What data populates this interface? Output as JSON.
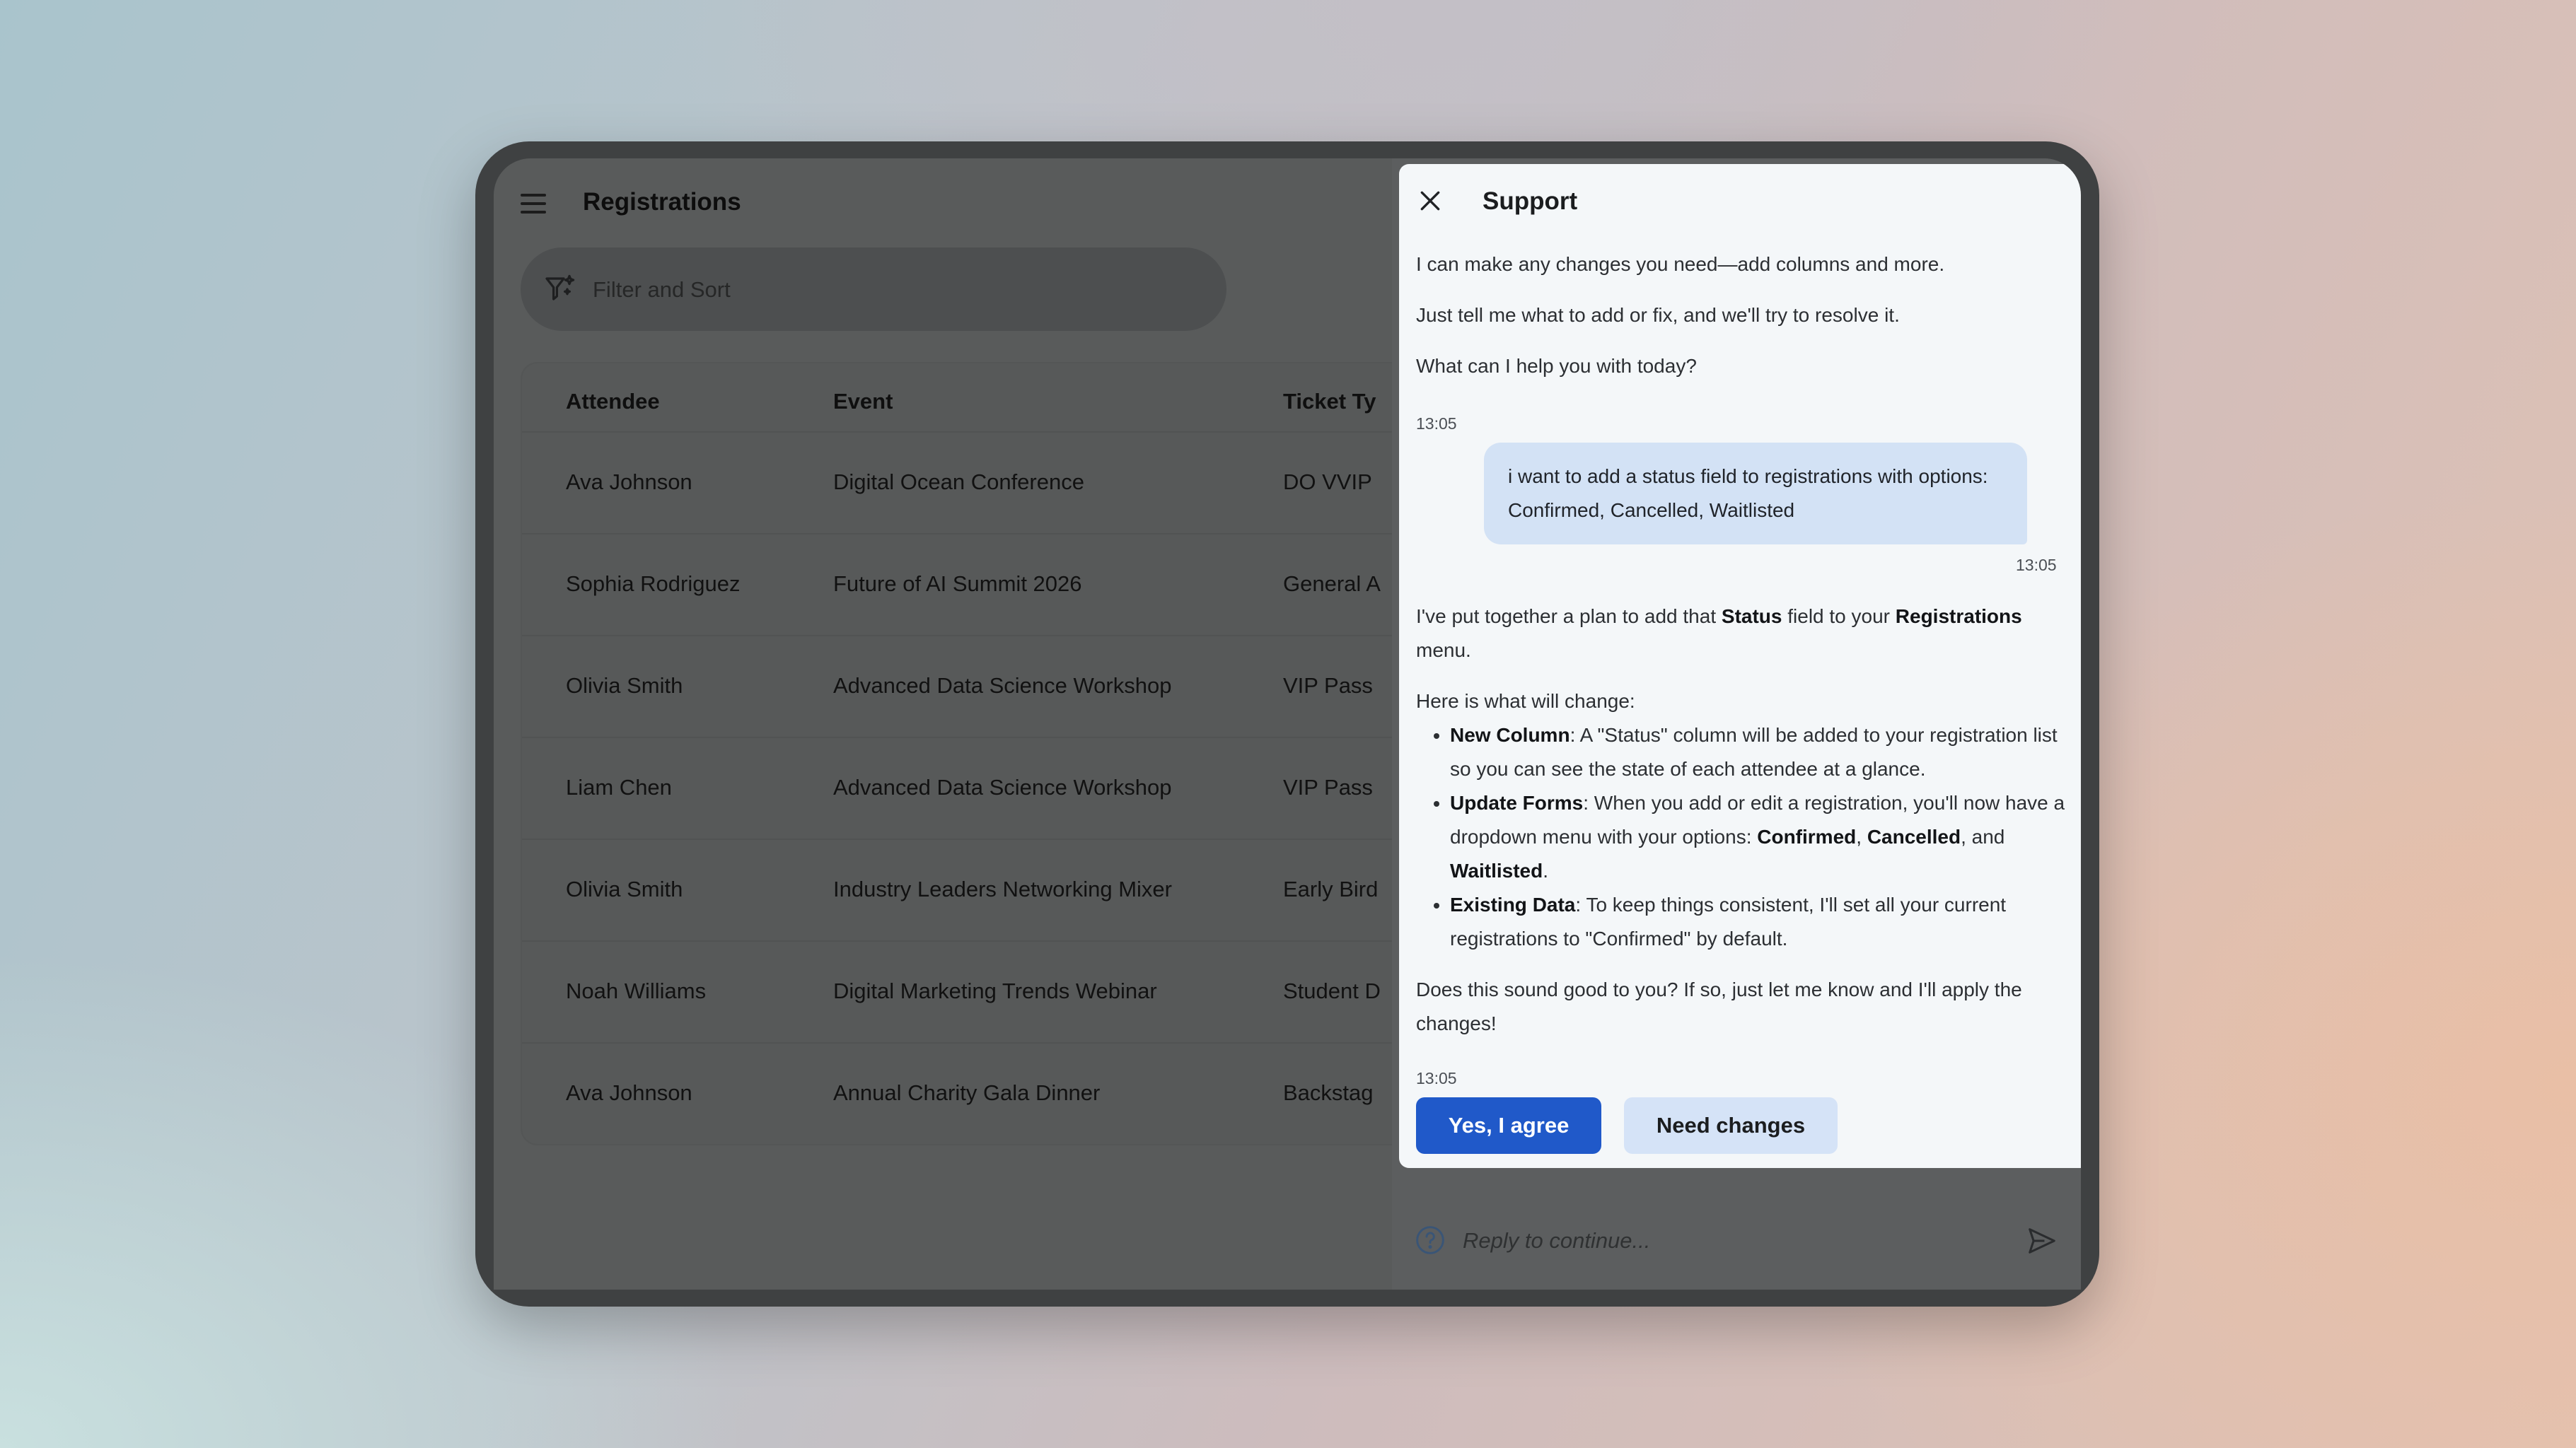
{
  "app": {
    "title": "Registrations",
    "filter_placeholder": "Filter and Sort"
  },
  "table": {
    "headers": [
      "Attendee",
      "Event",
      "Ticket Ty"
    ],
    "rows": [
      [
        "Ava Johnson",
        "Digital Ocean Conference",
        "DO VVIP"
      ],
      [
        "Sophia Rodriguez",
        "Future of AI Summit 2026",
        "General A"
      ],
      [
        "Olivia Smith",
        "Advanced Data Science Workshop",
        "VIP Pass"
      ],
      [
        "Liam Chen",
        "Advanced Data Science Workshop",
        "VIP Pass"
      ],
      [
        "Olivia Smith",
        "Industry Leaders Networking Mixer",
        "Early Bird"
      ],
      [
        "Noah Williams",
        "Digital Marketing Trends Webinar",
        "Student D"
      ],
      [
        "Ava Johnson",
        "Annual Charity Gala Dinner",
        "Backstag"
      ]
    ]
  },
  "support": {
    "title": "Support",
    "intro": [
      "I can make any changes you need—add columns and more.",
      "Just tell me what to add or fix, and we'll try to resolve it.",
      "What can I help you with today?"
    ],
    "time1": "13:05",
    "user_message": "i want to add a status field to registrations with options: Confirmed, Cancelled, Waitlisted",
    "time2": "13:05",
    "plan_intro_pre": "I've put together a plan to add that ",
    "plan_intro_field": "Status",
    "plan_intro_mid": " field to your ",
    "plan_intro_menu": "Registrations",
    "plan_intro_post": " menu.",
    "changes_heading": "Here is what will change:",
    "b1_title": "New Column",
    "b1_text": ": A \"Status\" column will be added to your registration list so you can see the state of each attendee at a glance.",
    "b2_title": "Update Forms",
    "b2_text": ": When you add or edit a registration, you'll now have a dropdown menu with your options: ",
    "b2_opt1": "Confirmed",
    "b2_sep1": ", ",
    "b2_opt2": "Cancelled",
    "b2_sep2": ", and ",
    "b2_opt3": "Waitlisted",
    "b2_end": ".",
    "b3_title": "Existing Data",
    "b3_text": ": To keep things consistent, I'll set all your current registrations to \"Confirmed\" by default.",
    "closing": "Does this sound good to you? If so, just let me know and I'll apply the changes!",
    "time3": "13:05",
    "agree_label": "Yes, I agree",
    "changes_label": "Need changes",
    "reply_placeholder": "Reply to continue..."
  },
  "colors": {
    "primary": "#2059c9",
    "secondary_button": "#d5e3f7",
    "user_bubble": "#d3e2f5"
  },
  "icons": [
    "menu-icon",
    "filter-sparkle-icon",
    "close-icon",
    "help-icon",
    "send-icon"
  ]
}
